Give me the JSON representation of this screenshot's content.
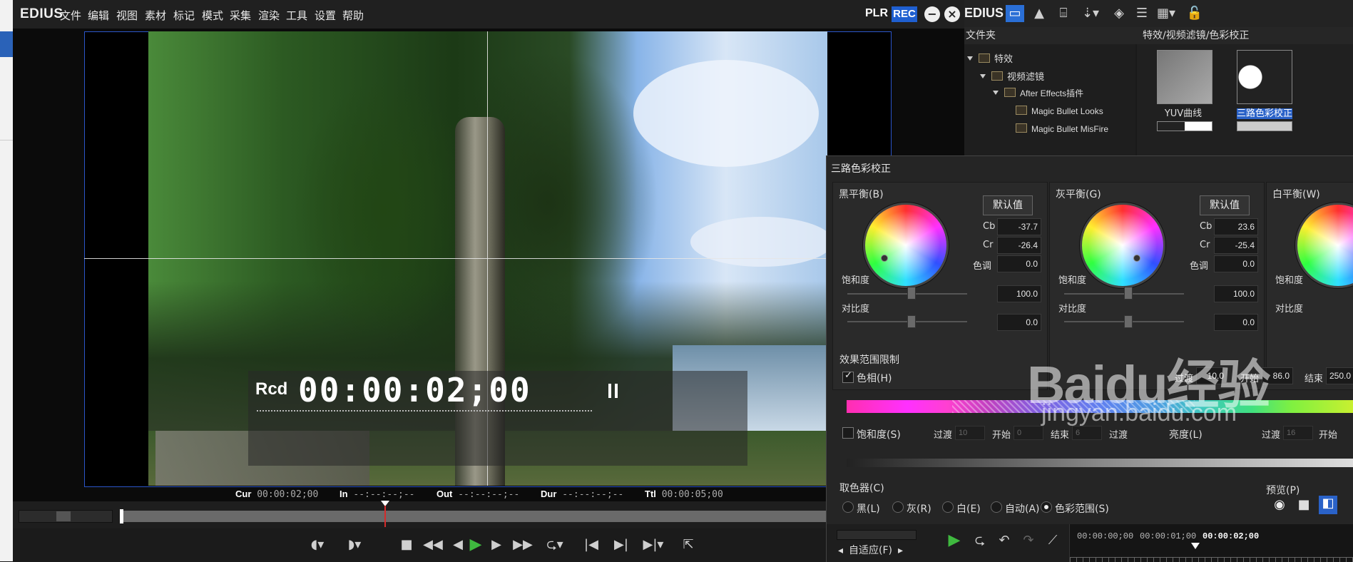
{
  "menubar": {
    "logo": "EDIUS",
    "items": [
      "文件",
      "编辑",
      "视图",
      "素材",
      "标记",
      "模式",
      "采集",
      "渲染",
      "工具",
      "设置",
      "帮助"
    ],
    "plr": "PLR",
    "rec": "REC"
  },
  "overlay": {
    "rcd": "Rcd",
    "timecode": "00:00:02;00"
  },
  "info": {
    "cur_label": "Cur",
    "cur": "00:00:02;00",
    "in_label": "In",
    "in": "--:--:--;--",
    "out_label": "Out",
    "out": "--:--:--;--",
    "dur_label": "Dur",
    "dur": "--:--:--;--",
    "ttl_label": "Ttl",
    "ttl": "00:00:05;00"
  },
  "right_panel": {
    "logo": "EDIUS",
    "tree_header": "文件夹",
    "tree": [
      "特效",
      "视频滤镜",
      "After Effects插件",
      "Magic Bullet Looks",
      "Magic Bullet MisFire"
    ],
    "effects_header": "特效/视频滤镜/色彩校正",
    "effects": [
      "YUV曲线",
      "三路色彩校正"
    ]
  },
  "dialog": {
    "title": "三路色彩校正",
    "black": {
      "label": "黑平衡(B)",
      "cb": "-37.7",
      "cr": "-26.4",
      "hue": "0.0",
      "sat": "100.0",
      "contrast": "0.0"
    },
    "gray": {
      "label": "灰平衡(G)",
      "cb": "23.6",
      "cr": "-25.4",
      "hue": "0.0",
      "sat": "100.0",
      "contrast": "0.0"
    },
    "white": {
      "label": "白平衡(W)"
    },
    "labels": {
      "default": "默认值",
      "cb": "Cb",
      "cr": "Cr",
      "hue": "色调",
      "sat": "饱和度",
      "contrast": "对比度"
    },
    "range": {
      "title": "效果范围限制",
      "hue_chk": "色相(H)",
      "transition_label": "过渡",
      "transition": "10.0",
      "start_label": "开始",
      "start": "86.0",
      "end_label": "结束",
      "end": "250.0",
      "sat_chk": "饱和度(S)",
      "sat_trans": "10",
      "sat_start": "0",
      "sat_end": "6",
      "lum_label": "亮度(L)",
      "lum_trans": "16",
      "lum_start_label": "开始"
    },
    "picker": {
      "title": "取色器(C)",
      "options": [
        "黑(L)",
        "灰(R)",
        "白(E)",
        "自动(A)",
        "色彩范围(S)"
      ],
      "preview": "预览(P)"
    },
    "bottom": {
      "fit": "自适应(F)",
      "tc1": "00:00:00;00",
      "tc2": "00:00:01;00",
      "tc3": "00:00:02;00"
    }
  },
  "watermark": {
    "main": "Baidu经验",
    "sub": "jingyan.baidu.com"
  }
}
